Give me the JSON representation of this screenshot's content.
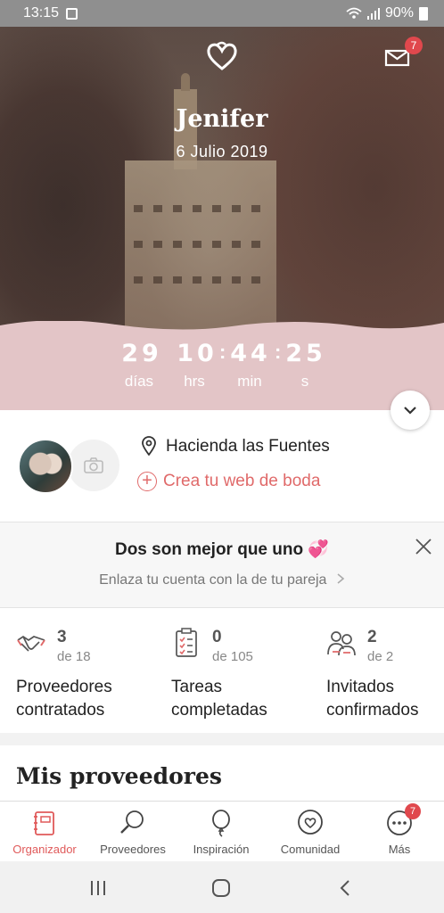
{
  "status_bar": {
    "time": "13:15",
    "battery": "90%"
  },
  "header": {
    "mail_badge": "7",
    "name": "Jenifer",
    "date": "6 Julio 2019"
  },
  "countdown": {
    "days": "29",
    "hours": "10",
    "minutes": "44",
    "seconds": "25",
    "days_label": "días",
    "hours_label": "hrs",
    "minutes_label": "min",
    "seconds_label": "s"
  },
  "venue": {
    "name": "Hacienda las Fuentes",
    "web_link": "Crea tu web de boda"
  },
  "partner_banner": {
    "title": "Dos son mejor que uno 💞",
    "subtitle": "Enlaza tu cuenta con la de tu pareja"
  },
  "stats": [
    {
      "count": "3",
      "total": "de 18",
      "label_line1": "Proveedores",
      "label_line2": "contratados",
      "icon": "handshake-icon"
    },
    {
      "count": "0",
      "total": "de 105",
      "label_line1": "Tareas",
      "label_line2": "completadas",
      "icon": "checklist-icon"
    },
    {
      "count": "2",
      "total": "de 2",
      "label_line1": "Invitados",
      "label_line2": "confirmados",
      "icon": "guests-icon"
    }
  ],
  "section": {
    "title": "Mis proveedores"
  },
  "bottom_nav": {
    "items": [
      {
        "label": "Organizador",
        "icon": "planner-icon",
        "active": true
      },
      {
        "label": "Proveedores",
        "icon": "search-icon"
      },
      {
        "label": "Inspiración",
        "icon": "balloon-icon"
      },
      {
        "label": "Comunidad",
        "icon": "chat-heart-icon"
      },
      {
        "label": "Más",
        "icon": "more-icon",
        "badge": "7"
      }
    ]
  },
  "colors": {
    "accent": "#e06a6a",
    "badge": "#e0484d",
    "pink_band": "#e3c5c7"
  }
}
